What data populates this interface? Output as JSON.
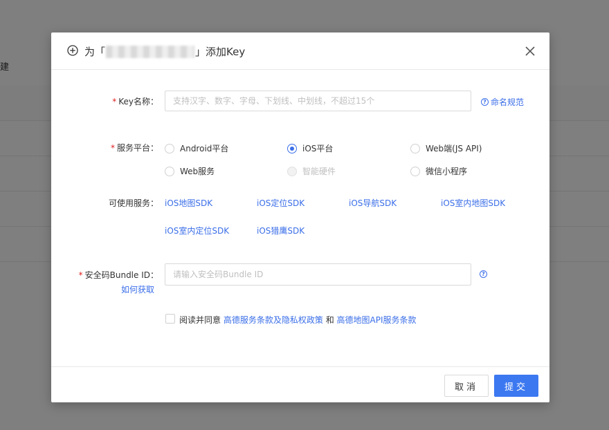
{
  "background": {
    "partial_text": "建"
  },
  "modal": {
    "title_prefix": "为「",
    "title_suffix": "」添加Key",
    "key_name": {
      "label": "Key名称：",
      "required_mark": "*",
      "placeholder": "支持汉字、数字、字母、下划线、中划线，不超过15个",
      "help_text": "命名规范"
    },
    "platform": {
      "label": "服务平台：",
      "required_mark": "*",
      "options": [
        {
          "label": "Android平台",
          "state": "unchecked"
        },
        {
          "label": "iOS平台",
          "state": "checked"
        },
        {
          "label": "Web端(JS API)",
          "state": "unchecked"
        },
        {
          "label": "Web服务",
          "state": "unchecked"
        },
        {
          "label": "智能硬件",
          "state": "disabled"
        },
        {
          "label": "微信小程序",
          "state": "unchecked"
        }
      ]
    },
    "services": {
      "label": "可使用服务：",
      "items": [
        "iOS地图SDK",
        "iOS定位SDK",
        "iOS导航SDK",
        "iOS室内地图SDK",
        "iOS室内定位SDK",
        "iOS猎鹰SDK"
      ]
    },
    "bundle": {
      "label": "安全码Bundle ID：",
      "required_mark": "*",
      "placeholder": "请输入安全码Bundle ID",
      "how_link": "如何获取"
    },
    "agreement": {
      "prefix": "阅读并同意",
      "link1": "高德服务条款及隐私权政策",
      "middle": "和",
      "link2": "高德地图API服务条款"
    },
    "buttons": {
      "cancel": "取消",
      "submit": "提交"
    }
  },
  "colors": {
    "accent": "#3a6ee8",
    "primary_button": "#3c78f0",
    "required": "#e02020"
  }
}
